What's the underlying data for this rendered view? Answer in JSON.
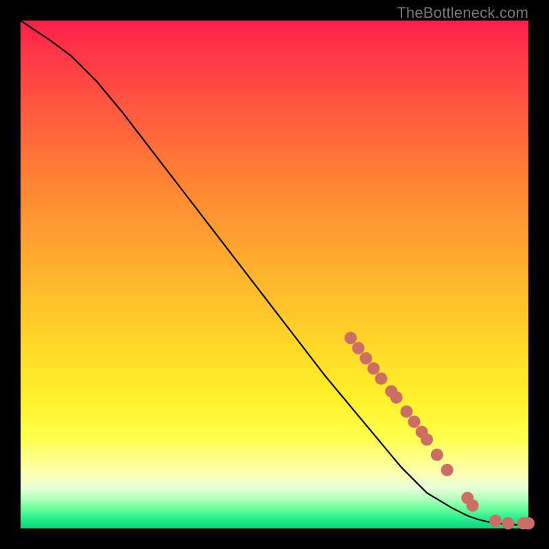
{
  "attribution": "TheBottleneck.com",
  "chart_data": {
    "type": "line",
    "title": "",
    "xlabel": "",
    "ylabel": "",
    "xlim": [
      0,
      100
    ],
    "ylim": [
      0,
      100
    ],
    "series": [
      {
        "name": "curve",
        "color": "#000000",
        "x": [
          0,
          3,
          6,
          10,
          15,
          20,
          30,
          40,
          50,
          60,
          65,
          70,
          75,
          80,
          85,
          88,
          90,
          92,
          94,
          96,
          98,
          100
        ],
        "y": [
          100,
          98,
          96,
          93,
          88,
          82,
          69,
          56,
          43,
          30,
          24,
          18,
          12,
          7,
          4,
          2.5,
          1.8,
          1.3,
          1.0,
          0.8,
          0.7,
          0.6
        ]
      }
    ],
    "markers": [
      {
        "x": 65.0,
        "y": 37.5
      },
      {
        "x": 66.5,
        "y": 35.5
      },
      {
        "x": 68.0,
        "y": 33.5
      },
      {
        "x": 69.5,
        "y": 31.5
      },
      {
        "x": 71.0,
        "y": 29.5
      },
      {
        "x": 73.0,
        "y": 27.0
      },
      {
        "x": 74.0,
        "y": 25.8
      },
      {
        "x": 76.0,
        "y": 23.0
      },
      {
        "x": 77.5,
        "y": 21.0
      },
      {
        "x": 79.0,
        "y": 19.0
      },
      {
        "x": 80.0,
        "y": 17.5
      },
      {
        "x": 82.0,
        "y": 14.5
      },
      {
        "x": 84.0,
        "y": 11.5
      },
      {
        "x": 88.0,
        "y": 6.0
      },
      {
        "x": 89.0,
        "y": 4.5
      },
      {
        "x": 93.5,
        "y": 1.5
      },
      {
        "x": 96.0,
        "y": 1.0
      },
      {
        "x": 99.0,
        "y": 1.0
      },
      {
        "x": 100.0,
        "y": 1.0
      }
    ],
    "marker_color": "#cc6e66",
    "marker_radius_px": 9
  }
}
